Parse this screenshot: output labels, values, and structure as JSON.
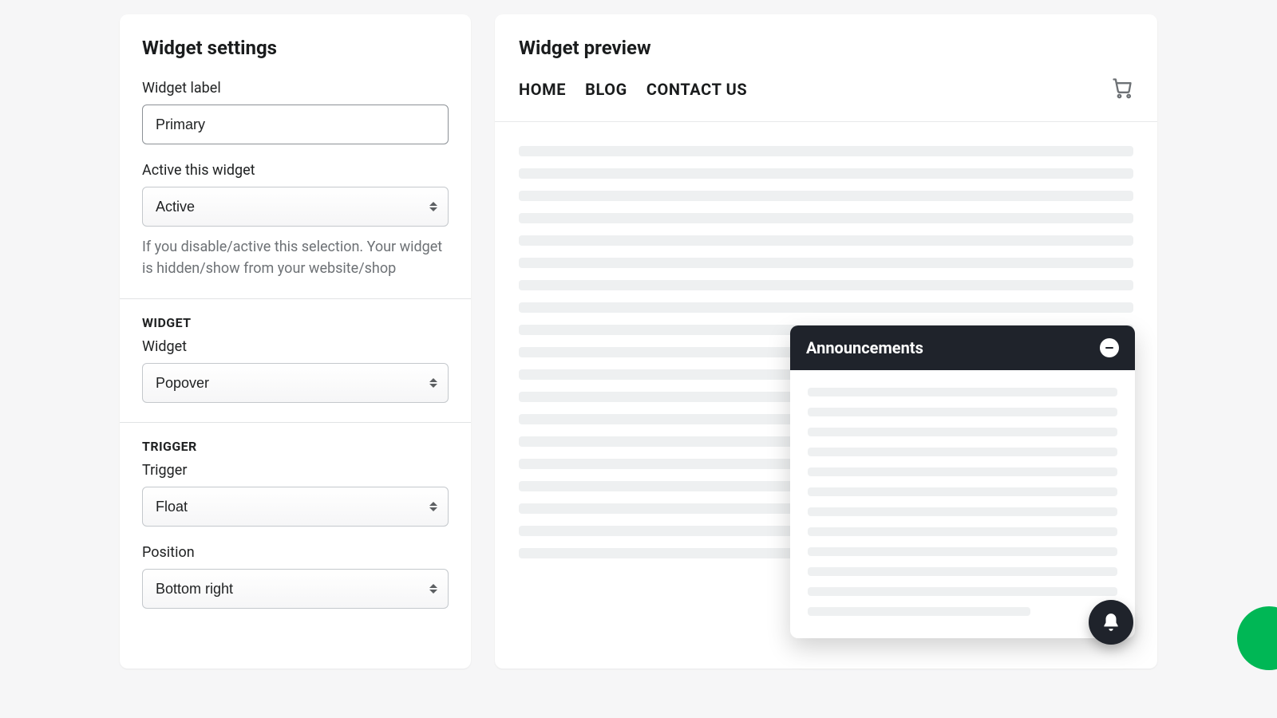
{
  "settings": {
    "title": "Widget settings",
    "widget_label": {
      "label": "Widget label",
      "value": "Primary"
    },
    "active": {
      "label": "Active this widget",
      "value": "Active",
      "help": "If you disable/active this selection. Your widget is hidden/show from your website/shop"
    },
    "widget_section": {
      "heading": "WIDGET",
      "label": "Widget",
      "value": "Popover"
    },
    "trigger_section": {
      "heading": "TRIGGER",
      "trigger": {
        "label": "Trigger",
        "value": "Float"
      },
      "position": {
        "label": "Position",
        "value": "Bottom right"
      }
    }
  },
  "preview": {
    "title": "Widget preview",
    "nav": {
      "home": "HOME",
      "blog": "BLOG",
      "contact": "CONTACT US"
    },
    "popover": {
      "title": "Announcements"
    }
  }
}
